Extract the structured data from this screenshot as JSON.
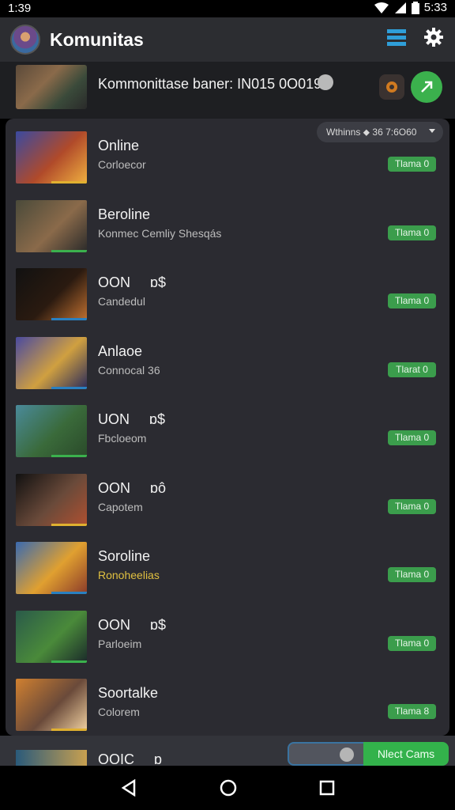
{
  "status_bar": {
    "time": "1:39",
    "battery_text": "5:33"
  },
  "app_bar": {
    "title": "Komunitas"
  },
  "banner": {
    "text": "Kommonittase baner: IN015 0O019."
  },
  "filter": {
    "label": "Wthinns ⬥ 36 7:6O60"
  },
  "rows": [
    {
      "title": "Online",
      "subtitle": "Corloecor",
      "pill": "Tlama 0",
      "subtitle_color": "#bdbdbd",
      "thumb_colors": [
        "#3a4aa0",
        "#b04a2a",
        "#f0b040"
      ],
      "bar_color": "#e0b030"
    },
    {
      "title": "Beroline",
      "subtitle": "Konmec Cemliy Shesqás",
      "pill": "Tlama 0",
      "subtitle_color": "#bdbdbd",
      "thumb_colors": [
        "#4a4a3a",
        "#8a6a4a",
        "#2a2a2a"
      ],
      "bar_color": "#3bb14d"
    },
    {
      "title": "OON",
      "subtitle": "Candedul",
      "extra": "ɒ$",
      "pill": "Tlama 0",
      "subtitle_color": "#bdbdbd",
      "thumb_colors": [
        "#111",
        "#2a1a10",
        "#c07030"
      ],
      "bar_color": "#2a80c0"
    },
    {
      "title": "Anlaoe",
      "subtitle": "Connocal 36",
      "pill": "Tlarat 0",
      "subtitle_color": "#bdbdbd",
      "thumb_colors": [
        "#4a4aa0",
        "#d0a040",
        "#2a2a5a"
      ],
      "bar_color": "#2a80c0"
    },
    {
      "title": "UON",
      "subtitle": "Fbcloeom",
      "extra": "ɒ$",
      "pill": "Tlama 0",
      "subtitle_color": "#bdbdbd",
      "thumb_colors": [
        "#4a8a9a",
        "#3a6a3a",
        "#2a4a2a"
      ],
      "bar_color": "#3bb14d"
    },
    {
      "title": "OON",
      "subtitle": "Capotem",
      "extra": "ɒô",
      "pill": "Tlama 0",
      "subtitle_color": "#bdbdbd",
      "thumb_colors": [
        "#111",
        "#6a4a3a",
        "#b05030"
      ],
      "bar_color": "#e0b030"
    },
    {
      "title": "Soroline",
      "subtitle": "Ronoheelias",
      "pill": "Tlama 0",
      "subtitle_color": "#e0c040",
      "thumb_colors": [
        "#3a6ab0",
        "#e0a030",
        "#8a3a2a"
      ],
      "bar_color": "#2a80c0"
    },
    {
      "title": "OON",
      "subtitle": "Parloeim",
      "extra": "ɒ$",
      "pill": "Tlama 0",
      "subtitle_color": "#bdbdbd",
      "thumb_colors": [
        "#2a5a4a",
        "#4a8a3a",
        "#1a2a2a"
      ],
      "bar_color": "#3bb14d"
    },
    {
      "title": "Soortalke",
      "subtitle": "Colorem",
      "pill": "Tlama 8",
      "subtitle_color": "#bdbdbd",
      "thumb_colors": [
        "#d08030",
        "#6a4a3a",
        "#f0d0a0"
      ],
      "bar_color": "#e0b030"
    }
  ],
  "bottom": {
    "partial_title": "OOIC",
    "partial_extra": "ɒ",
    "button_label": "Nlect Cams"
  },
  "icons": {
    "signal": "signal-icon",
    "menu": "menu-icon",
    "settings": "gear-icon",
    "back": "back-icon",
    "home": "home-icon",
    "recents": "recents-icon"
  },
  "colors": {
    "accent": "#3bb14d",
    "menu_icon": "#2f9ed8",
    "panel": "#2b2b31"
  }
}
